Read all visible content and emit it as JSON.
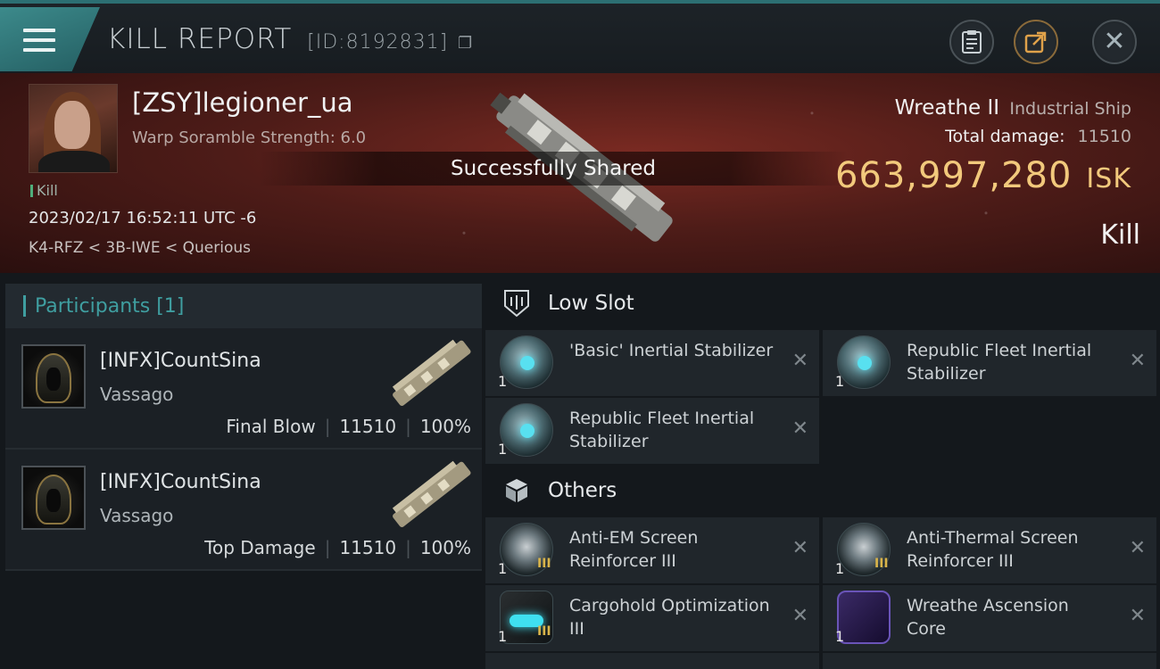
{
  "header": {
    "title": "KILL REPORT",
    "report_id": "[ID:8192831]"
  },
  "victim": {
    "name": "[ZSY]legioner_ua",
    "subtitle": "Warp Soramble Strength: 6.0",
    "tag": "Kill",
    "datetime": "2023/02/17 16:52:11 UTC -6",
    "location": "K4-RFZ < 3B-IWE < Querious"
  },
  "shared_banner": "Successfully Shared",
  "ship": {
    "name": "Wreathe II",
    "class": "Industrial Ship",
    "damage_label": "Total damage:",
    "damage_value": "11510",
    "isk_value": "663,997,280",
    "isk_unit": "ISK",
    "result": "Kill"
  },
  "participants": {
    "title": "Participants [1]",
    "rows": [
      {
        "name": "[INFX]CountSina",
        "ship": "Vassago",
        "role": "Final Blow",
        "damage": "11510",
        "percent": "100%"
      },
      {
        "name": "[INFX]CountSina",
        "ship": "Vassago",
        "role": "Top Damage",
        "damage": "11510",
        "percent": "100%"
      }
    ]
  },
  "low_slot": {
    "title": "Low Slot",
    "items": [
      {
        "name": "'Basic' Inertial Stabilizer",
        "qty": "1",
        "icon": "inertial-stabilizer-icon"
      },
      {
        "name": "Republic Fleet Inertial Stabilizer",
        "qty": "1",
        "icon": "inertial-stabilizer-icon"
      },
      {
        "name": "Republic Fleet Inertial Stabilizer",
        "qty": "1",
        "icon": "inertial-stabilizer-icon"
      }
    ]
  },
  "others": {
    "title": "Others",
    "items": [
      {
        "name": "Anti-EM Screen Reinforcer III",
        "qty": "1",
        "tier": "III",
        "icon": "shield-rig-icon"
      },
      {
        "name": "Anti-Thermal Screen Reinforcer III",
        "qty": "1",
        "tier": "III",
        "icon": "shield-rig-icon"
      },
      {
        "name": "Cargohold Optimization III",
        "qty": "1",
        "tier": "III",
        "icon": "cargo-rig-icon"
      },
      {
        "name": "Wreathe Ascension Core",
        "qty": "1",
        "tier": "",
        "icon": "ascension-core-icon"
      }
    ]
  },
  "colors": {
    "accent": "#3f9ea0",
    "isk": "#f2c97c",
    "hero_red": "#7a2a22"
  }
}
